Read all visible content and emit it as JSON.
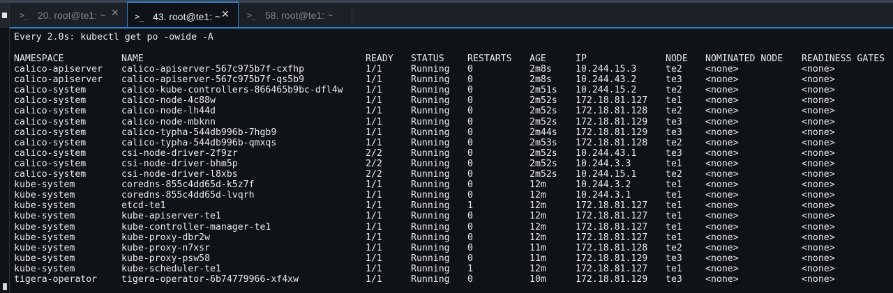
{
  "tabs": [
    {
      "label": "20. root@te1: ~",
      "prompt": ">_",
      "close": "✕"
    },
    {
      "label": "43. root@te1: ~",
      "prompt": ">_",
      "close": "✕"
    },
    {
      "label": "58. root@te1: ~",
      "prompt": ">_"
    }
  ],
  "terminal": {
    "command_line": "Every 2.0s: kubectl get po -owide -A",
    "headers": [
      "NAMESPACE",
      "NAME",
      "READY",
      "STATUS",
      "RESTARTS",
      "AGE",
      "IP",
      "NODE",
      "NOMINATED NODE",
      "READINESS GATES"
    ],
    "rows": [
      [
        "calico-apiserver",
        "calico-apiserver-567c975b7f-cxfhp",
        "1/1",
        "Running",
        "0",
        "2m8s",
        "10.244.15.3",
        "te2",
        "<none>",
        "<none>"
      ],
      [
        "calico-apiserver",
        "calico-apiserver-567c975b7f-qs5b9",
        "1/1",
        "Running",
        "0",
        "2m8s",
        "10.244.43.2",
        "te3",
        "<none>",
        "<none>"
      ],
      [
        "calico-system",
        "calico-kube-controllers-866465b9bc-dfl4w",
        "1/1",
        "Running",
        "0",
        "2m51s",
        "10.244.15.2",
        "te2",
        "<none>",
        "<none>"
      ],
      [
        "calico-system",
        "calico-node-4c88w",
        "1/1",
        "Running",
        "0",
        "2m52s",
        "172.18.81.127",
        "te1",
        "<none>",
        "<none>"
      ],
      [
        "calico-system",
        "calico-node-lh44d",
        "1/1",
        "Running",
        "0",
        "2m52s",
        "172.18.81.128",
        "te2",
        "<none>",
        "<none>"
      ],
      [
        "calico-system",
        "calico-node-mbknn",
        "1/1",
        "Running",
        "0",
        "2m52s",
        "172.18.81.129",
        "te3",
        "<none>",
        "<none>"
      ],
      [
        "calico-system",
        "calico-typha-544db996b-7hgb9",
        "1/1",
        "Running",
        "0",
        "2m44s",
        "172.18.81.129",
        "te3",
        "<none>",
        "<none>"
      ],
      [
        "calico-system",
        "calico-typha-544db996b-qmxqs",
        "1/1",
        "Running",
        "0",
        "2m53s",
        "172.18.81.128",
        "te2",
        "<none>",
        "<none>"
      ],
      [
        "calico-system",
        "csi-node-driver-2f9zr",
        "2/2",
        "Running",
        "0",
        "2m52s",
        "10.244.43.1",
        "te3",
        "<none>",
        "<none>"
      ],
      [
        "calico-system",
        "csi-node-driver-bhm5p",
        "2/2",
        "Running",
        "0",
        "2m52s",
        "10.244.3.3",
        "te1",
        "<none>",
        "<none>"
      ],
      [
        "calico-system",
        "csi-node-driver-l8xbs",
        "2/2",
        "Running",
        "0",
        "2m52s",
        "10.244.15.1",
        "te2",
        "<none>",
        "<none>"
      ],
      [
        "kube-system",
        "coredns-855c4dd65d-k5z7f",
        "1/1",
        "Running",
        "0",
        "12m",
        "10.244.3.2",
        "te1",
        "<none>",
        "<none>"
      ],
      [
        "kube-system",
        "coredns-855c4dd65d-lvqrh",
        "1/1",
        "Running",
        "0",
        "12m",
        "10.244.3.1",
        "te1",
        "<none>",
        "<none>"
      ],
      [
        "kube-system",
        "etcd-te1",
        "1/1",
        "Running",
        "1",
        "12m",
        "172.18.81.127",
        "te1",
        "<none>",
        "<none>"
      ],
      [
        "kube-system",
        "kube-apiserver-te1",
        "1/1",
        "Running",
        "0",
        "12m",
        "172.18.81.127",
        "te1",
        "<none>",
        "<none>"
      ],
      [
        "kube-system",
        "kube-controller-manager-te1",
        "1/1",
        "Running",
        "0",
        "12m",
        "172.18.81.127",
        "te1",
        "<none>",
        "<none>"
      ],
      [
        "kube-system",
        "kube-proxy-dbr2w",
        "1/1",
        "Running",
        "0",
        "12m",
        "172.18.81.127",
        "te1",
        "<none>",
        "<none>"
      ],
      [
        "kube-system",
        "kube-proxy-n7xsr",
        "1/1",
        "Running",
        "0",
        "11m",
        "172.18.81.128",
        "te2",
        "<none>",
        "<none>"
      ],
      [
        "kube-system",
        "kube-proxy-psw58",
        "1/1",
        "Running",
        "0",
        "11m",
        "172.18.81.129",
        "te3",
        "<none>",
        "<none>"
      ],
      [
        "kube-system",
        "kube-scheduler-te1",
        "1/1",
        "Running",
        "1",
        "12m",
        "172.18.81.127",
        "te1",
        "<none>",
        "<none>"
      ],
      [
        "tigera-operator",
        "tigera-operator-6b74779966-xf4xw",
        "1/1",
        "Running",
        "0",
        "10m",
        "172.18.81.129",
        "te3",
        "<none>",
        "<none>"
      ]
    ]
  },
  "colors": {
    "background": "#0f1216",
    "tabbar": "#1d2026",
    "accent": "#2f80c8",
    "text": "#eaeaea",
    "inactive_tab_text": "#7d8591"
  }
}
